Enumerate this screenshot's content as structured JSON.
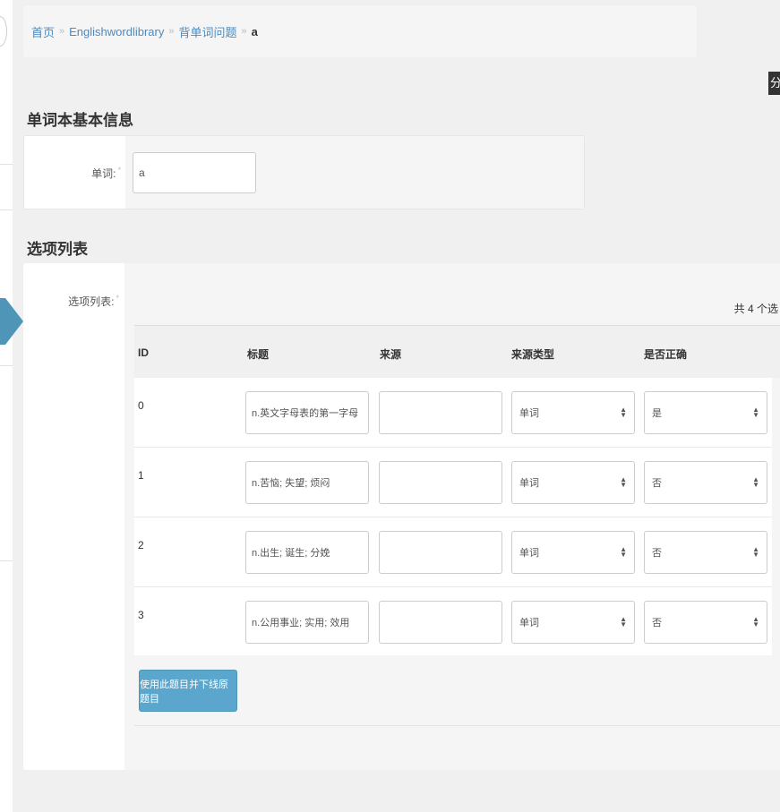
{
  "breadcrumb": {
    "home": "首页",
    "app": "Englishwordlibrary",
    "model": "背单词问题",
    "current": "a",
    "separator": "»"
  },
  "section1": {
    "title": "单词本基本信息",
    "word_label": "单词:",
    "required_mark": "*",
    "word_value": "a"
  },
  "section2": {
    "title": "选项列表",
    "options_label": "选项列表:",
    "required_mark": "*",
    "count_text": "共 4 个选"
  },
  "table": {
    "headers": [
      "ID",
      "标题",
      "来源",
      "来源类型",
      "是否正确"
    ],
    "rows": [
      {
        "id": "0",
        "title": "n.英文字母表的第一字母",
        "source": "",
        "source_type": "单词",
        "correct": "是"
      },
      {
        "id": "1",
        "title": "n.苦恼; 失望; 烦闷",
        "source": "",
        "source_type": "单词",
        "correct": "否"
      },
      {
        "id": "2",
        "title": "n.出生; 诞生; 分娩",
        "source": "",
        "source_type": "单词",
        "correct": "否"
      },
      {
        "id": "3",
        "title": "n.公用事业; 实用; 效用",
        "source": "",
        "source_type": "单词",
        "correct": "否"
      }
    ]
  },
  "actions": {
    "use_button": "使用此题目并下线原题目"
  },
  "right_badge": "分",
  "colors": {
    "link": "#4a8bc1",
    "button": "#5aa6cc",
    "left_tab": "#4f95b7"
  }
}
